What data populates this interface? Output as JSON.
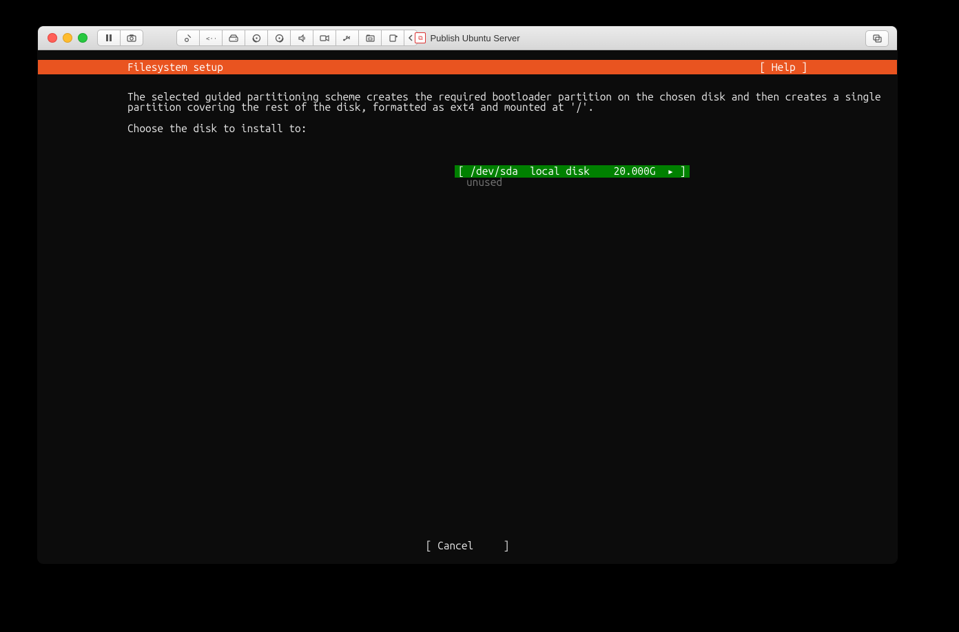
{
  "window": {
    "title": "Publish Ubuntu Server"
  },
  "header": {
    "title": "Filesystem setup",
    "help": "[ Help ]"
  },
  "body": {
    "line1": "The selected guided partitioning scheme creates the required bootloader partition on the chosen disk and then creates a single",
    "line2": "partition covering the rest of the disk, formatted as ext4 and mounted at '/'.",
    "prompt": "Choose the disk to install to:"
  },
  "disk": {
    "row": "[ /dev/sda  local disk    20.000G  ▸ ]",
    "status": "unused"
  },
  "footer": {
    "cancel": "[ Cancel     ]"
  }
}
